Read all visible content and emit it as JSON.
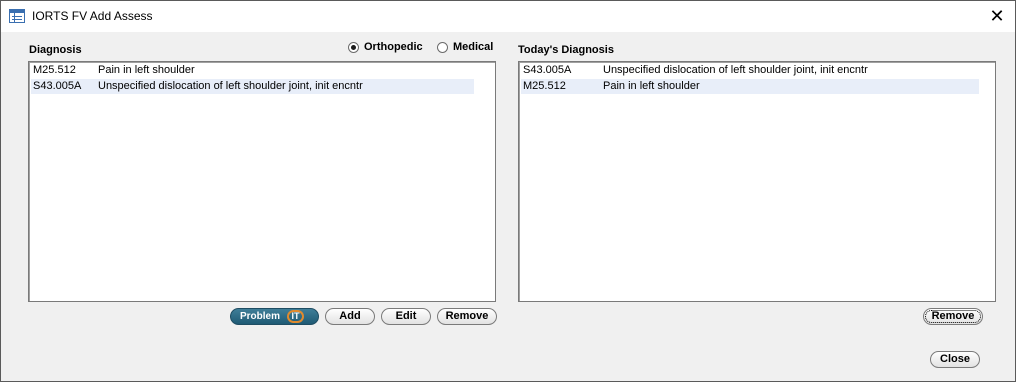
{
  "window": {
    "title": "IORTS FV Add Assess"
  },
  "left_panel": {
    "title": "Diagnosis",
    "radio_options": [
      {
        "label": "Orthopedic",
        "checked": true
      },
      {
        "label": "Medical",
        "checked": false
      }
    ],
    "items": [
      {
        "code": "M25.512",
        "description": "Pain in left shoulder",
        "selected": false
      },
      {
        "code": "S43.005A",
        "description": "Unspecified dislocation of left shoulder joint, init encntr",
        "selected": true
      }
    ],
    "buttons": {
      "problem": "Problem",
      "problem_badge": "IT",
      "add": "Add",
      "edit": "Edit",
      "remove": "Remove"
    }
  },
  "right_panel": {
    "title": "Today's Diagnosis",
    "items": [
      {
        "code": "S43.005A",
        "description": "Unspecified dislocation of left shoulder joint, init encntr",
        "selected": false
      },
      {
        "code": "M25.512",
        "description": "Pain in left shoulder",
        "selected": true
      }
    ],
    "buttons": {
      "remove": "Remove"
    }
  },
  "footer": {
    "close_label": "Close"
  },
  "colors": {
    "selection": "#e8eef9",
    "problem_button": "#2a6a86",
    "badge_ring": "#e08a2e"
  }
}
